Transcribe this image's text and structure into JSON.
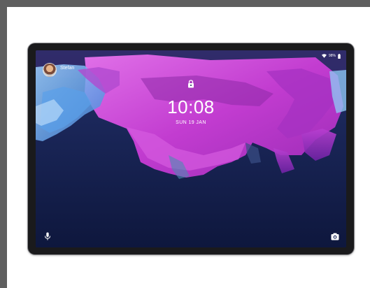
{
  "lock_screen": {
    "user_name": "Stefan",
    "time": "10:08",
    "date": "SUN 19 JAN"
  },
  "status_bar": {
    "battery_level": "98%"
  },
  "icons": {
    "lock": "lock-icon",
    "mic": "microphone-icon",
    "camera": "camera-icon",
    "wifi": "wifi-icon",
    "battery": "battery-icon"
  },
  "colors": {
    "accent": "#c23cd0",
    "background_outer": "#5f5f5f",
    "screen_deep": "#162256",
    "device_frame": "#1a1a1c"
  }
}
